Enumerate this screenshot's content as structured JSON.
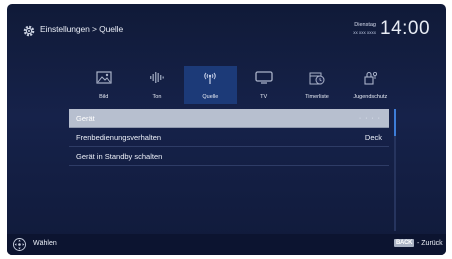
{
  "header": {
    "breadcrumb": "Einstellungen > Quelle",
    "day": "Dienstag",
    "date": "xx xxx xxxx",
    "time": "14:00"
  },
  "tabs": [
    {
      "label": "Bild",
      "icon": "picture-icon",
      "active": false
    },
    {
      "label": "Ton",
      "icon": "sound-icon",
      "active": false
    },
    {
      "label": "Quelle",
      "icon": "antenna-icon",
      "active": true
    },
    {
      "label": "TV",
      "icon": "tv-icon",
      "active": false
    },
    {
      "label": "Timerliste",
      "icon": "timer-icon",
      "active": false
    },
    {
      "label": "Jugendschutz",
      "icon": "lock-icon",
      "active": false
    }
  ],
  "menu": {
    "items": [
      {
        "label": "Gerät",
        "value": "· · · ·",
        "selected": true
      },
      {
        "label": "Frenbedienungsverhalten",
        "value": "Deck",
        "selected": false
      },
      {
        "label": "Gerät in Standby schalten",
        "value": "",
        "selected": false
      }
    ]
  },
  "footer": {
    "select_label": "Wählen",
    "back_key": "BACK",
    "back_label": "- Zurück"
  },
  "colors": {
    "background": "#16224a",
    "active_tab": "#1c3a78",
    "selected_row": "#b7bfcf",
    "scroll_thumb": "#3d7dd8"
  }
}
